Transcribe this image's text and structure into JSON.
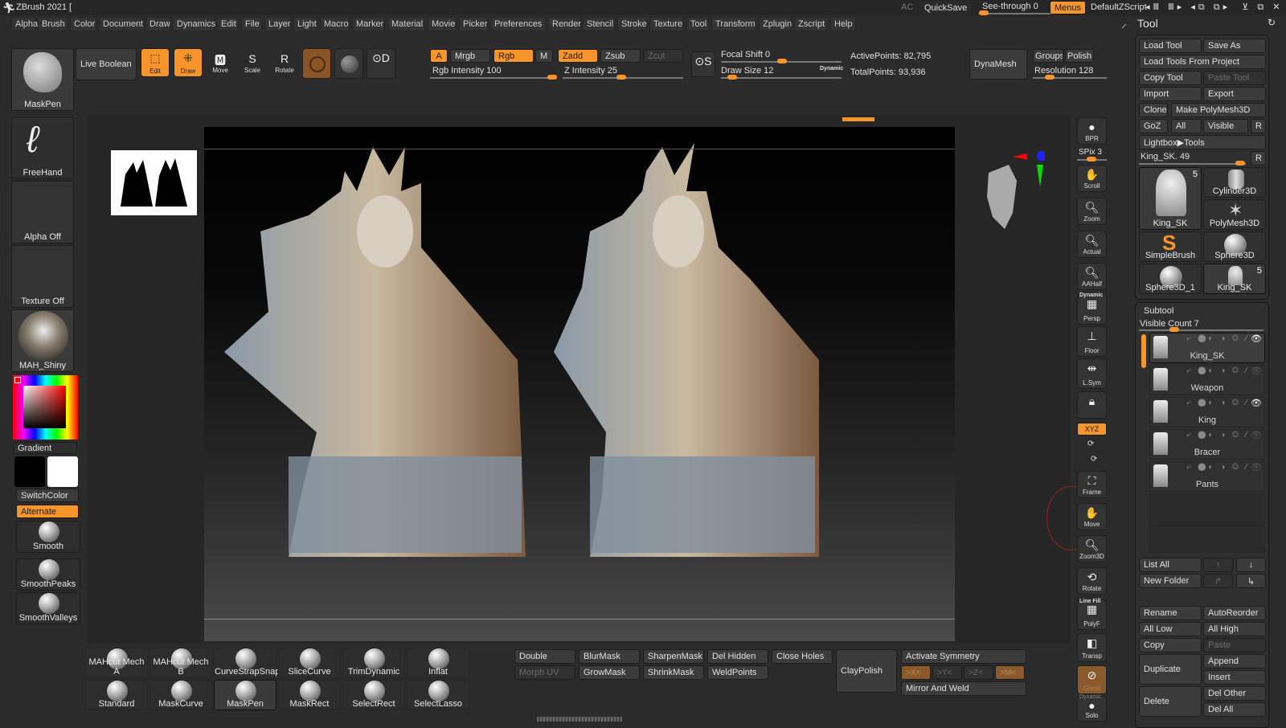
{
  "title_bar": {
    "app_title": "ZBrush 2021 [",
    "ac": "AC",
    "quicksave": "QuickSave",
    "see_through": "See-through  0",
    "see_through_value": 0,
    "menus": "Menus",
    "script": "DefaultZScript"
  },
  "menus": [
    "Alpha",
    "Brush",
    "Color",
    "Document",
    "Draw",
    "Dynamics",
    "Edit",
    "File",
    "Layer",
    "Light",
    "Macro",
    "Marker",
    "Material",
    "Movie",
    "Picker",
    "Preferences",
    "Render",
    "Stencil",
    "Stroke",
    "Texture",
    "Tool",
    "Transform",
    "Zplugin",
    "Zscript",
    "Help"
  ],
  "top_shelf": {
    "live_boolean": "Live Boolean",
    "edit": "Edit",
    "draw": "Draw",
    "move": "Move",
    "scale": "Scale",
    "rotate": "Rotate",
    "a": "A",
    "mrgb": "Mrgb",
    "rgb": "Rgb",
    "m": "M",
    "zadd": "Zadd",
    "zsub": "Zsub",
    "zcut": "Zcut",
    "rgb_intensity": "Rgb Intensity 100",
    "rgb_intensity_value": 100,
    "z_intensity": "Z Intensity 25",
    "z_intensity_value": 25,
    "focal_shift": "Focal Shift 0",
    "draw_size": "Draw Size 12",
    "dynamic": "Dynamic",
    "active_points": "ActivePoints: 82,795",
    "total_points": "TotalPoints: 93,936",
    "dynamesh": "DynaMesh",
    "groups": "Groups",
    "polish": "Polish",
    "resolution": "Resolution 128"
  },
  "left_shelf": {
    "brush": "MaskPen",
    "stroke": "FreeHand",
    "alpha": "Alpha Off",
    "texture": "Texture Off",
    "material": "MAH_Shiny",
    "gradient": "Gradient",
    "switch_color": "SwitchColor",
    "alternate": "Alternate",
    "main_color": "#ff0000",
    "secondary_color": "#ffffff",
    "brushes": [
      "Smooth",
      "SmoothPeaks",
      "SmoothValleys"
    ]
  },
  "right_toolbar": {
    "bpr": "BPR",
    "spix": "SPix 3",
    "scroll": "Scroll",
    "zoom": "Zoom",
    "actual": "Actual",
    "aahalf": "AAHalf",
    "dynamic": "Dynamic",
    "persp": "Persp",
    "floor": "Floor",
    "lsym": "L.Sym",
    "xyz": "XYZ",
    "frame": "Frame",
    "move": "Move",
    "zoom3d": "Zoom3D",
    "rotate": "Rotate",
    "line_fill": "Line Fill",
    "polyf": "PolyF",
    "transp": "Transp",
    "ghost": "Ghost",
    "solo_dynamic": "Dynamic",
    "solo": "Solo"
  },
  "tool_panel": {
    "title": "Tool",
    "load_tool": "Load Tool",
    "save_as": "Save As",
    "load_from_project": "Load Tools From Project",
    "copy_tool": "Copy Tool",
    "paste_tool": "Paste Tool",
    "import": "Import",
    "export": "Export",
    "clone": "Clone",
    "make_polymesh": "Make PolyMesh3D",
    "goz": "GoZ",
    "all": "All",
    "visible": "Visible",
    "r": "R",
    "lightbox": "Lightbox▶Tools",
    "current_tool": "King_SK. 49",
    "tools": [
      {
        "name": "King_SK",
        "count": "5"
      },
      {
        "name": "Cylinder3D"
      },
      {
        "name": "PolyMesh3D"
      },
      {
        "name": "SimpleBrush"
      },
      {
        "name": "Sphere3D"
      },
      {
        "name": "Sphere3D_1"
      },
      {
        "name": "King_SK",
        "count": "5"
      }
    ]
  },
  "subtool": {
    "title": "Subtool",
    "visible_count": "Visible Count 7",
    "items": [
      {
        "name": "King_SK",
        "visible": true,
        "selected": true
      },
      {
        "name": "Weapon",
        "visible": false
      },
      {
        "name": "King",
        "visible": true
      },
      {
        "name": "Bracer",
        "visible": false
      },
      {
        "name": "Pants",
        "visible": false
      }
    ],
    "list_all": "List All",
    "new_folder": "New Folder",
    "rename": "Rename",
    "autoreorder": "AutoReorder",
    "all_low": "All Low",
    "all_high": "All High",
    "copy": "Copy",
    "paste": "Paste",
    "duplicate": "Duplicate",
    "append": "Append",
    "insert": "Insert",
    "delete": "Delete",
    "del_other": "Del Other",
    "del_all": "Del All"
  },
  "bottom_shelf": {
    "brushes_row1": [
      "MAHcut Mech A",
      "MAHcut Mech B",
      "CurveStrapSnap",
      "SliceCurve",
      "TrimDynamic",
      "Inflat"
    ],
    "brushes_row2": [
      "Standard",
      "MaskCurve",
      "MaskPen",
      "MaskRect",
      "SelectRect",
      "SelectLasso"
    ],
    "double": "Double",
    "blurmask": "BlurMask",
    "sharpenmask": "SharpenMask",
    "del_hidden": "Del Hidden",
    "close_holes": "Close Holes",
    "morph_uv": "Morph UV",
    "growmask": "GrowMask",
    "shrinkmask": "ShrinkMask",
    "weldpoints": "WeldPoints",
    "claypolish": "ClayPolish",
    "activate_symmetry": "Activate Symmetry",
    "sym_x": ">X<",
    "sym_y": ">Y<",
    "sym_z": ">Z<",
    "sym_m": ">M<",
    "mirror_weld": "Mirror And Weld"
  },
  "colors": {
    "accent": "#f7952b",
    "background": "#2b2b2b"
  }
}
